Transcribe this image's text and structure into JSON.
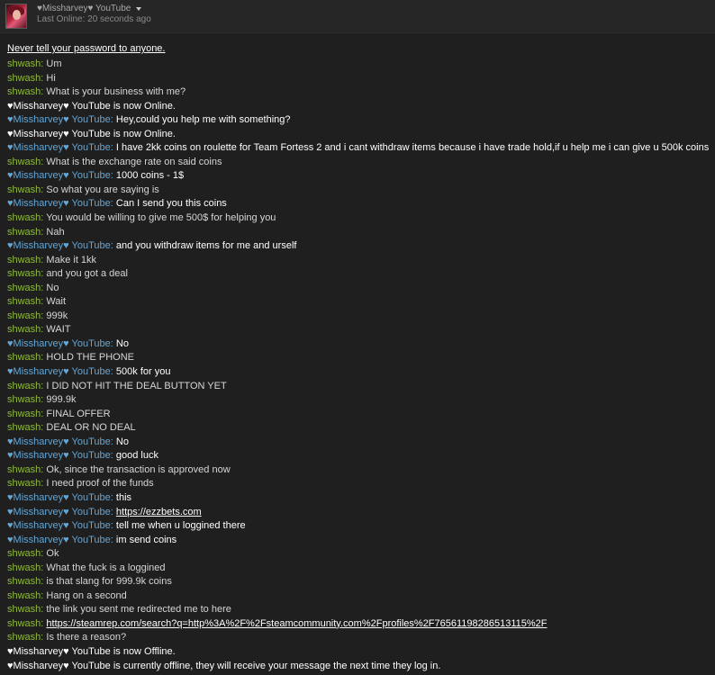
{
  "header": {
    "name": "♥Missharvey♥ YouTube",
    "status": "Last Online: 20 seconds ago"
  },
  "colors": {
    "shwash": "#90ba3c",
    "miss": "#62a7d8"
  },
  "warning": "Never tell your password to anyone.",
  "messages": [
    {
      "t": "msg",
      "who": "shwash",
      "text": "Um"
    },
    {
      "t": "msg",
      "who": "shwash",
      "text": "Hi"
    },
    {
      "t": "msg",
      "who": "shwash",
      "text": "What is your business with me?"
    },
    {
      "t": "sys",
      "text": "♥Missharvey♥ YouTube is now Online."
    },
    {
      "t": "msg",
      "who": "miss",
      "text": "Hey,could you help me with something?"
    },
    {
      "t": "sys",
      "text": "♥Missharvey♥ YouTube is now Online."
    },
    {
      "t": "msg",
      "who": "miss",
      "text": "I have 2kk coins on  roulette for Team Fortess 2 and i cant withdraw items because i have trade hold,if u help me i can give u 500k coins"
    },
    {
      "t": "msg",
      "who": "shwash",
      "text": "What is the exchange rate on said coins"
    },
    {
      "t": "msg",
      "who": "miss",
      "text": "1000 coins - 1$"
    },
    {
      "t": "msg",
      "who": "shwash",
      "text": "So what you are saying is"
    },
    {
      "t": "msg",
      "who": "miss",
      "text": "Can I send you this coins"
    },
    {
      "t": "msg",
      "who": "shwash",
      "text": "You would be willing to give me 500$ for helping you"
    },
    {
      "t": "msg",
      "who": "shwash",
      "text": "Nah"
    },
    {
      "t": "msg",
      "who": "miss",
      "text": "and you withdraw items for me and urself"
    },
    {
      "t": "msg",
      "who": "shwash",
      "text": "Make it 1kk"
    },
    {
      "t": "msg",
      "who": "shwash",
      "text": "and you got a deal"
    },
    {
      "t": "msg",
      "who": "shwash",
      "text": "No"
    },
    {
      "t": "msg",
      "who": "shwash",
      "text": "Wait"
    },
    {
      "t": "msg",
      "who": "shwash",
      "text": "999k"
    },
    {
      "t": "msg",
      "who": "shwash",
      "text": "WAIT"
    },
    {
      "t": "msg",
      "who": "miss",
      "text": "No"
    },
    {
      "t": "msg",
      "who": "shwash",
      "text": "HOLD THE PHONE"
    },
    {
      "t": "msg",
      "who": "miss",
      "text": "500k for you"
    },
    {
      "t": "msg",
      "who": "shwash",
      "text": "I DID NOT HIT THE DEAL BUTTON YET"
    },
    {
      "t": "msg",
      "who": "shwash",
      "text": "999.9k"
    },
    {
      "t": "msg",
      "who": "shwash",
      "text": "FINAL OFFER"
    },
    {
      "t": "msg",
      "who": "shwash",
      "text": "DEAL OR NO DEAL"
    },
    {
      "t": "msg",
      "who": "miss",
      "text": "No"
    },
    {
      "t": "msg",
      "who": "miss",
      "text": "good luck"
    },
    {
      "t": "msg",
      "who": "shwash",
      "text": "Ok, since the transaction is approved now"
    },
    {
      "t": "msg",
      "who": "shwash",
      "text": "I need proof of the funds"
    },
    {
      "t": "msg",
      "who": "miss",
      "text": "this"
    },
    {
      "t": "msg",
      "who": "miss",
      "text": "https://ezzbets.com",
      "link": true
    },
    {
      "t": "msg",
      "who": "miss",
      "text": "tell me when u loggined there"
    },
    {
      "t": "msg",
      "who": "miss",
      "text": "im send coins"
    },
    {
      "t": "msg",
      "who": "shwash",
      "text": "Ok"
    },
    {
      "t": "msg",
      "who": "shwash",
      "text": "What the fuck is a loggined"
    },
    {
      "t": "msg",
      "who": "shwash",
      "text": "is that slang for 999.9k coins"
    },
    {
      "t": "msg",
      "who": "shwash",
      "text": "Hang on a second"
    },
    {
      "t": "msg",
      "who": "shwash",
      "text": "the link you sent me redirected me to here"
    },
    {
      "t": "msg",
      "who": "shwash",
      "text": "https://steamrep.com/search?q=http%3A%2F%2Fsteamcommunity.com%2Fprofiles%2F76561198286513115%2F",
      "link": true
    },
    {
      "t": "msg",
      "who": "shwash",
      "text": "Is there a reason?"
    },
    {
      "t": "sys",
      "text": "♥Missharvey♥ YouTube is now Offline."
    },
    {
      "t": "sys",
      "text": "♥Missharvey♥ YouTube is currently offline, they will receive your message the next time they log in."
    }
  ],
  "senders": {
    "shwash": "shwash",
    "miss": "♥Missharvey♥ YouTube"
  }
}
